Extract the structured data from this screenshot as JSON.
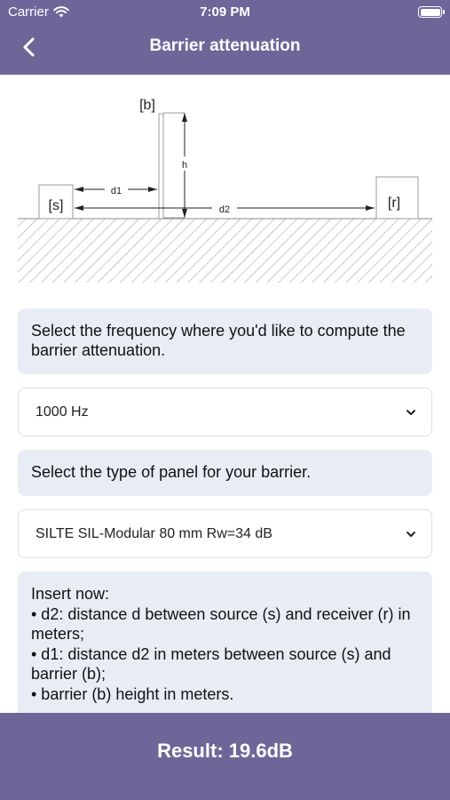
{
  "status_bar": {
    "carrier": "Carrier",
    "time": "7:09 PM"
  },
  "nav": {
    "title": "Barrier attenuation"
  },
  "diagram": {
    "barrier_label": "[b]",
    "source_label": "[s]",
    "receiver_label": "[r]",
    "height_label": "h",
    "d1_label": "d1",
    "d2_label": "d2"
  },
  "frequency_prompt": "Select the frequency where you'd like to compute the barrier attenuation.",
  "frequency_select": {
    "value": "1000 Hz"
  },
  "panel_prompt": "Select the type of panel for your barrier.",
  "panel_select": {
    "value": "SILTE SIL-Modular 80 mm Rw=34 dB"
  },
  "instructions": {
    "heading": "Insert now:",
    "items": [
      "• d2: distance d between source (s) and receiver (r) in meters;",
      "• d1: distance d2 in meters between source (s) and barrier (b);",
      "• barrier (b) height in meters."
    ]
  },
  "result": {
    "text": "Result: 19.6dB"
  }
}
